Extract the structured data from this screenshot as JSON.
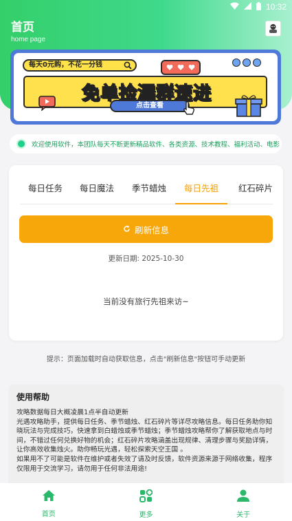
{
  "status_bar": {
    "time": "10:32"
  },
  "header": {
    "title": "首页",
    "subtitle": "home page"
  },
  "banner": {
    "pill_text": "每天0元购，不花一分钱",
    "main_text": "免单捡漏群速进",
    "button_text": "点击查看"
  },
  "notice": {
    "text": "欢迎使用软件，本团队每天不断更新精品软件、各类资源、技术教程、福利活动、电影"
  },
  "tabs": [
    {
      "label": "每日任务",
      "active": false
    },
    {
      "label": "每日魔法",
      "active": false
    },
    {
      "label": "季节蜡烛",
      "active": false
    },
    {
      "label": "每日先祖",
      "active": true
    },
    {
      "label": "红石碎片",
      "active": false
    }
  ],
  "main": {
    "refresh_label": "刷新信息",
    "update_date": "更新日期: 2025-10-30",
    "empty_message": "当前没有旅行先祖来访~"
  },
  "hint": "提示：页面加载时自动获取信息，点击\"刷新信息\"按钮可手动更新",
  "help": {
    "title": "使用帮助",
    "lines": [
      "攻略数据每日大概凌晨1点半自动更新",
      "光遇攻略助手，提供每日任务、季节蜡烛、红石碎片等详尽攻略信息。每日任务助你知晓玩法与完成技巧，快速拿到白蜡烛或季节蜡烛；季节蜡烛攻略帮你了解获取地点与时间，不错过任何兑换好物的机会；红石碎片攻略涵盖出现规律、清理步骤与奖励详情，让你高效收集烛火。助你畅玩光遇，轻松探索天空王国 。",
      "如果用不了可能是软件在维护或者失效了请及时反馈，软件资源来源于网络收集，程序仅限用于交流学习，请勿用于任何非法用途!"
    ]
  },
  "bottom_nav": [
    {
      "label": "首页",
      "icon": "home-icon"
    },
    {
      "label": "更多",
      "icon": "apps-icon"
    },
    {
      "label": "关于",
      "icon": "user-icon"
    }
  ],
  "colors": {
    "primary_green": "#34cf6a",
    "accent_orange": "#f7a70a",
    "nav_green": "#2bb86a",
    "notice_green": "#1e9e5e"
  }
}
